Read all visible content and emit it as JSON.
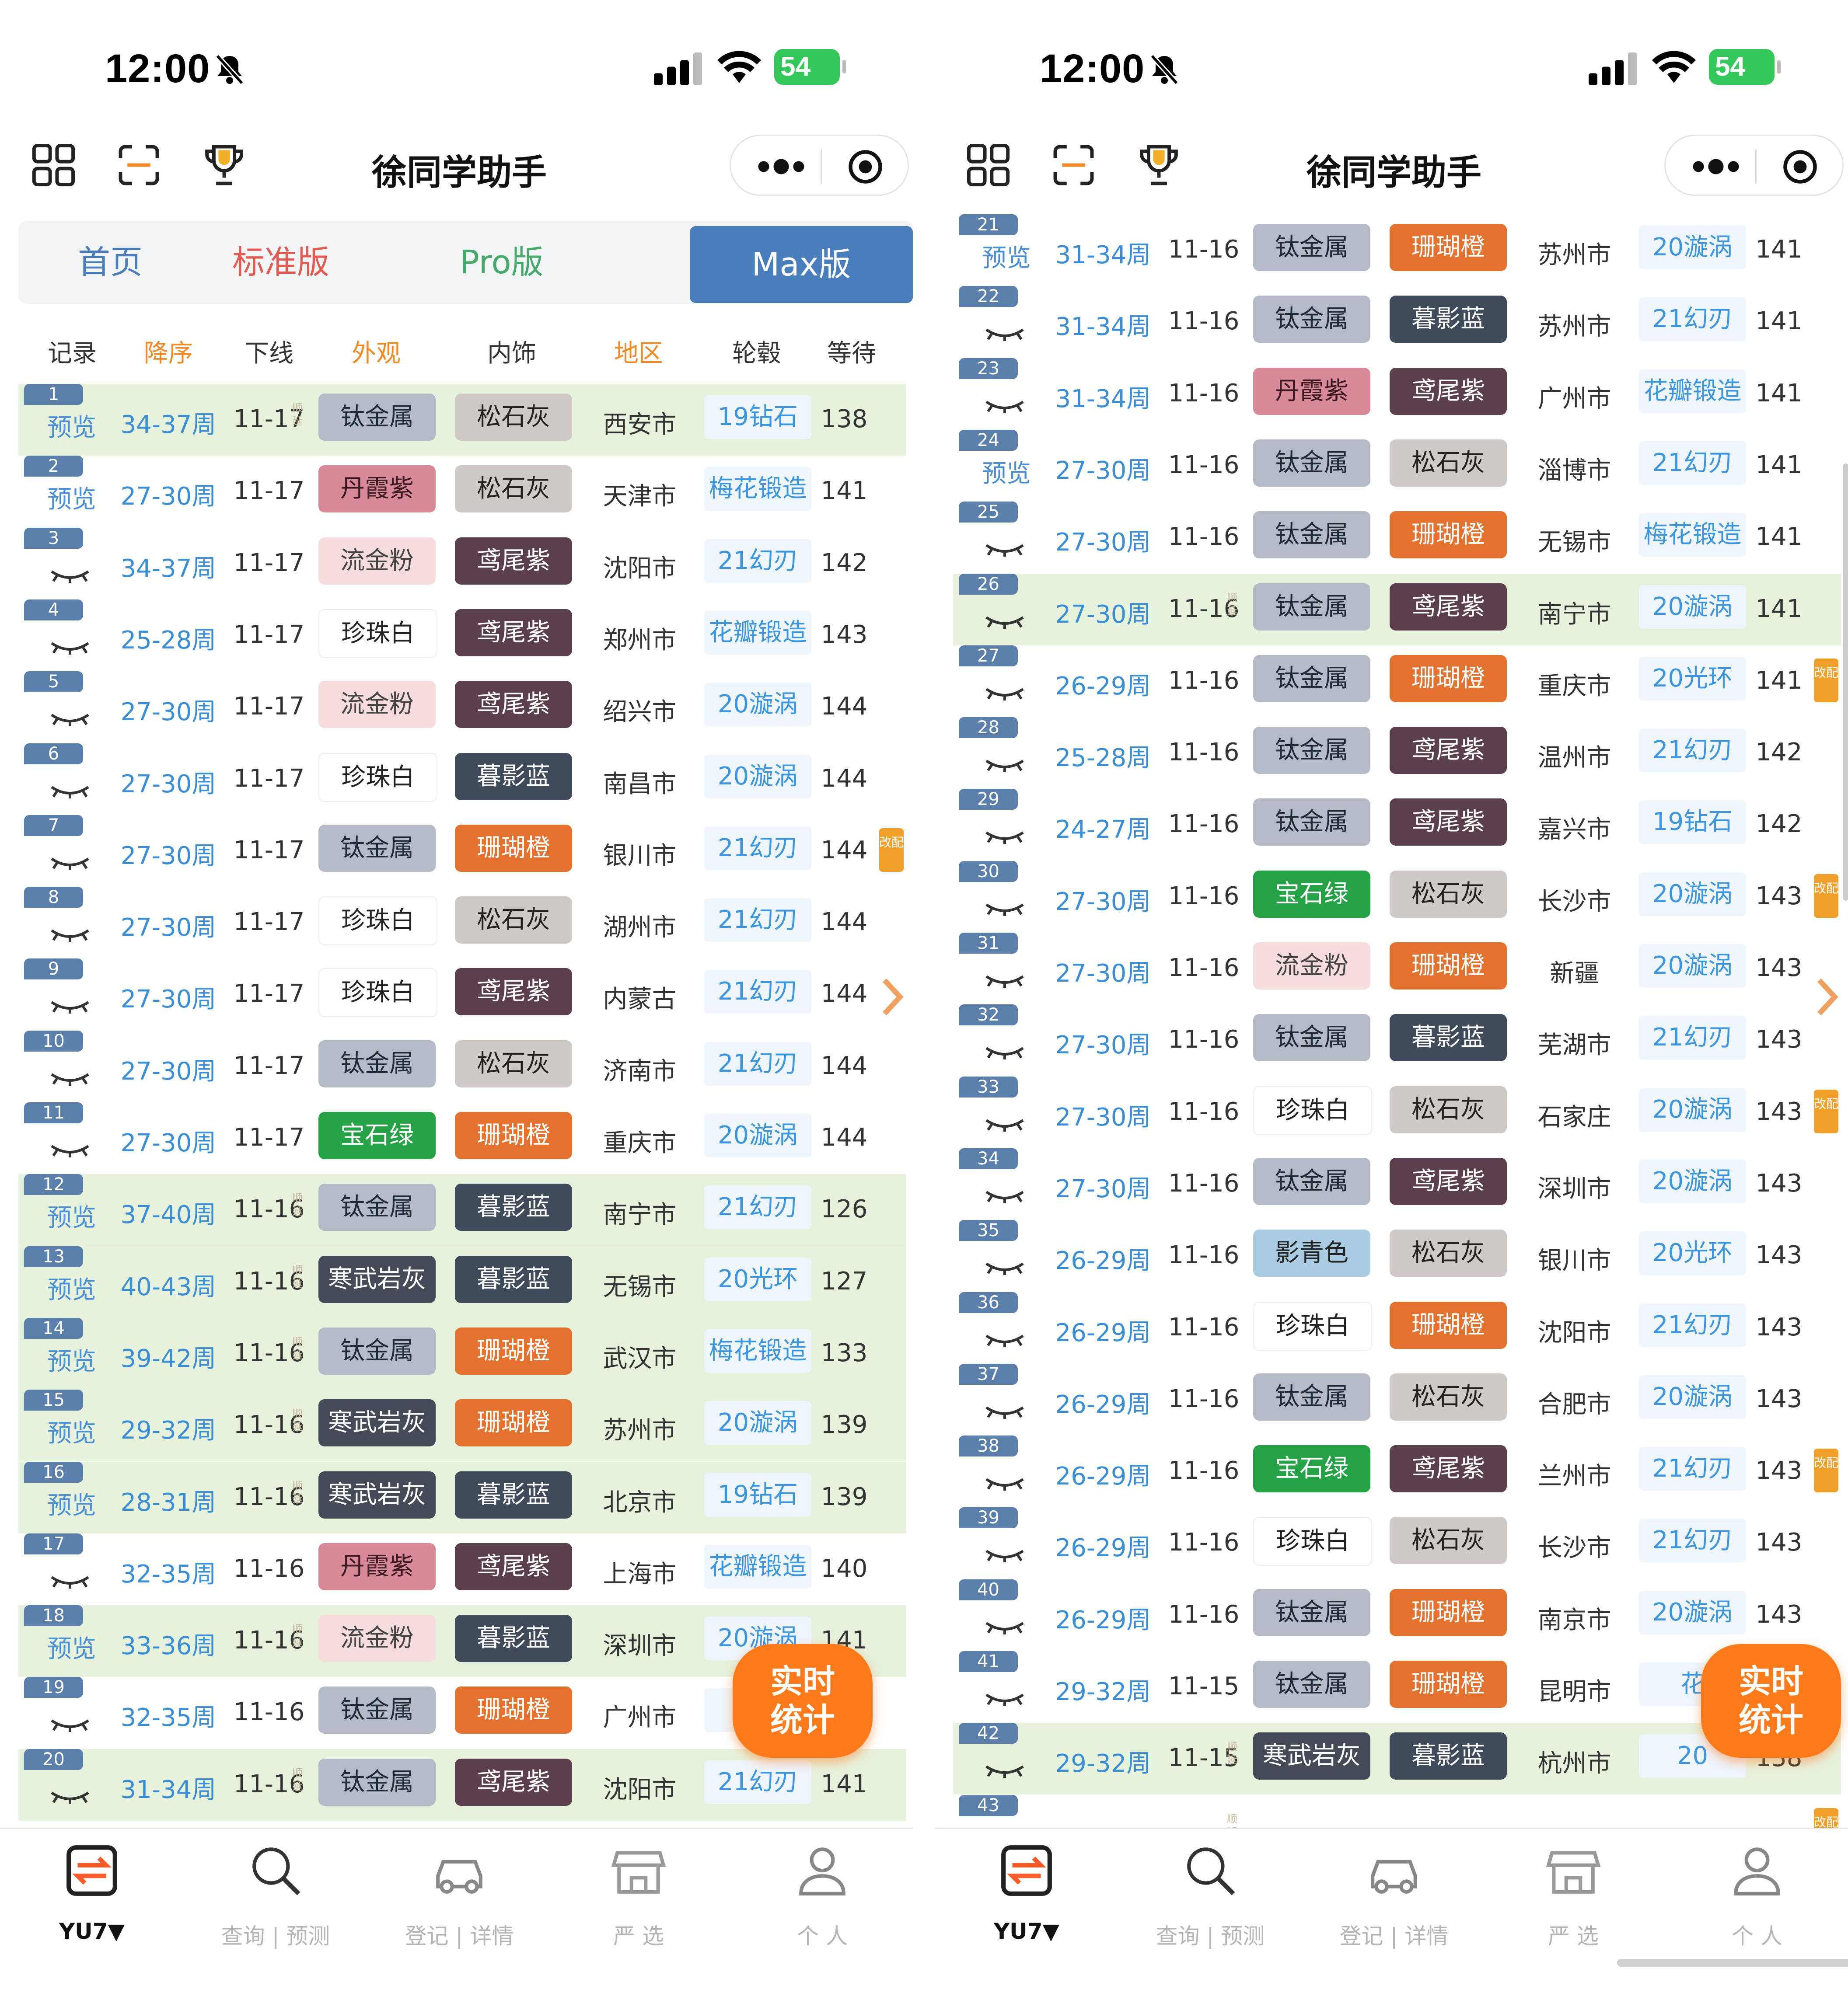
{
  "screens": [
    {
      "status": {
        "time": "12:00",
        "battery": "54"
      },
      "nav": {
        "title": "徐同学助手"
      },
      "tabs": [
        "首页",
        "标准版",
        "Pro版",
        "Max版"
      ],
      "header": [
        "记录",
        "降序",
        "下线",
        "外观",
        "内饰",
        "地区",
        "轮毂",
        "等待"
      ],
      "rows": [
        {
          "n": "1",
          "tag": "预览",
          "cycle": "34-37周",
          "date": "11-17",
          "ext": "钛金属",
          "int": "松石灰",
          "region": "西安市",
          "wheel": "19钻石",
          "wait": "138",
          "green": true,
          "stamp": true,
          "mod": false
        },
        {
          "n": "2",
          "tag": "预览",
          "cycle": "27-30周",
          "date": "11-17",
          "ext": "丹霞紫",
          "int": "松石灰",
          "region": "天津市",
          "wheel": "梅花锻造",
          "wait": "141",
          "green": false,
          "stamp": false,
          "mod": false
        },
        {
          "n": "3",
          "tag": "",
          "cycle": "34-37周",
          "date": "11-17",
          "ext": "流金粉",
          "int": "鸢尾紫",
          "region": "沈阳市",
          "wheel": "21幻刃",
          "wait": "142",
          "green": false,
          "stamp": false,
          "mod": false
        },
        {
          "n": "4",
          "tag": "",
          "cycle": "25-28周",
          "date": "11-17",
          "ext": "珍珠白",
          "int": "鸢尾紫",
          "region": "郑州市",
          "wheel": "花瓣锻造",
          "wait": "143",
          "green": false,
          "stamp": false,
          "mod": false
        },
        {
          "n": "5",
          "tag": "",
          "cycle": "27-30周",
          "date": "11-17",
          "ext": "流金粉",
          "int": "鸢尾紫",
          "region": "绍兴市",
          "wheel": "20漩涡",
          "wait": "144",
          "green": false,
          "stamp": false,
          "mod": false
        },
        {
          "n": "6",
          "tag": "",
          "cycle": "27-30周",
          "date": "11-17",
          "ext": "珍珠白",
          "int": "暮影蓝",
          "region": "南昌市",
          "wheel": "20漩涡",
          "wait": "144",
          "green": false,
          "stamp": false,
          "mod": false
        },
        {
          "n": "7",
          "tag": "",
          "cycle": "27-30周",
          "date": "11-17",
          "ext": "钛金属",
          "int": "珊瑚橙",
          "region": "银川市",
          "wheel": "21幻刃",
          "wait": "144",
          "green": false,
          "stamp": false,
          "mod": true
        },
        {
          "n": "8",
          "tag": "",
          "cycle": "27-30周",
          "date": "11-17",
          "ext": "珍珠白",
          "int": "松石灰",
          "region": "湖州市",
          "wheel": "21幻刃",
          "wait": "144",
          "green": false,
          "stamp": false,
          "mod": false
        },
        {
          "n": "9",
          "tag": "",
          "cycle": "27-30周",
          "date": "11-17",
          "ext": "珍珠白",
          "int": "鸢尾紫",
          "region": "内蒙古",
          "wheel": "21幻刃",
          "wait": "144",
          "green": false,
          "stamp": false,
          "mod": false
        },
        {
          "n": "10",
          "tag": "",
          "cycle": "27-30周",
          "date": "11-17",
          "ext": "钛金属",
          "int": "松石灰",
          "region": "济南市",
          "wheel": "21幻刃",
          "wait": "144",
          "green": false,
          "stamp": false,
          "mod": false
        },
        {
          "n": "11",
          "tag": "",
          "cycle": "27-30周",
          "date": "11-17",
          "ext": "宝石绿",
          "int": "珊瑚橙",
          "region": "重庆市",
          "wheel": "20漩涡",
          "wait": "144",
          "green": false,
          "stamp": false,
          "mod": false
        },
        {
          "n": "12",
          "tag": "预览",
          "cycle": "37-40周",
          "date": "11-16",
          "ext": "钛金属",
          "int": "暮影蓝",
          "region": "南宁市",
          "wheel": "21幻刃",
          "wait": "126",
          "green": true,
          "stamp": true,
          "mod": false
        },
        {
          "n": "13",
          "tag": "预览",
          "cycle": "40-43周",
          "date": "11-16",
          "ext": "寒武岩灰",
          "int": "暮影蓝",
          "region": "无锡市",
          "wheel": "20光环",
          "wait": "127",
          "green": true,
          "stamp": true,
          "mod": false
        },
        {
          "n": "14",
          "tag": "预览",
          "cycle": "39-42周",
          "date": "11-16",
          "ext": "钛金属",
          "int": "珊瑚橙",
          "region": "武汉市",
          "wheel": "梅花锻造",
          "wait": "133",
          "green": true,
          "stamp": true,
          "mod": false
        },
        {
          "n": "15",
          "tag": "预览",
          "cycle": "29-32周",
          "date": "11-16",
          "ext": "寒武岩灰",
          "int": "珊瑚橙",
          "region": "苏州市",
          "wheel": "20漩涡",
          "wait": "139",
          "green": true,
          "stamp": true,
          "mod": false
        },
        {
          "n": "16",
          "tag": "预览",
          "cycle": "28-31周",
          "date": "11-16",
          "ext": "寒武岩灰",
          "int": "暮影蓝",
          "region": "北京市",
          "wheel": "19钻石",
          "wait": "139",
          "green": true,
          "stamp": true,
          "mod": false
        },
        {
          "n": "17",
          "tag": "",
          "cycle": "32-35周",
          "date": "11-16",
          "ext": "丹霞紫",
          "int": "鸢尾紫",
          "region": "上海市",
          "wheel": "花瓣锻造",
          "wait": "140",
          "green": false,
          "stamp": false,
          "mod": false
        },
        {
          "n": "18",
          "tag": "预览",
          "cycle": "33-36周",
          "date": "11-16",
          "ext": "流金粉",
          "int": "暮影蓝",
          "region": "深圳市",
          "wheel": "20漩涡",
          "wait": "141",
          "green": true,
          "stamp": true,
          "mod": false
        },
        {
          "n": "19",
          "tag": "",
          "cycle": "32-35周",
          "date": "11-16",
          "ext": "钛金属",
          "int": "珊瑚橙",
          "region": "广州市",
          "wheel": "2",
          "wait": "",
          "green": false,
          "stamp": false,
          "mod": false
        },
        {
          "n": "20",
          "tag": "",
          "cycle": "31-34周",
          "date": "11-16",
          "ext": "钛金属",
          "int": "鸢尾紫",
          "region": "沈阳市",
          "wheel": "21幻刃",
          "wait": "141",
          "green": true,
          "stamp": true,
          "mod": false
        }
      ],
      "fab": {
        "line1": "实时",
        "line2": "统计"
      },
      "tabbar": [
        {
          "label": "YU7▼",
          "icon": "swap-icon"
        },
        {
          "label": "查询 | 预测",
          "icon": "search-icon"
        },
        {
          "label": "登记 | 详情",
          "icon": "car-icon"
        },
        {
          "label": "严 选",
          "icon": "store-icon"
        },
        {
          "label": "个 人",
          "icon": "person-icon"
        }
      ]
    },
    {
      "status": {
        "time": "12:00",
        "battery": "54"
      },
      "nav": {
        "title": "徐同学助手"
      },
      "rows": [
        {
          "n": "21",
          "tag": "预览",
          "cycle": "31-34周",
          "date": "11-16",
          "ext": "钛金属",
          "int": "珊瑚橙",
          "region": "苏州市",
          "wheel": "20漩涡",
          "wait": "141",
          "green": false,
          "stamp": false,
          "mod": false
        },
        {
          "n": "22",
          "tag": "",
          "cycle": "31-34周",
          "date": "11-16",
          "ext": "钛金属",
          "int": "暮影蓝",
          "region": "苏州市",
          "wheel": "21幻刃",
          "wait": "141",
          "green": false,
          "stamp": false,
          "mod": false
        },
        {
          "n": "23",
          "tag": "",
          "cycle": "31-34周",
          "date": "11-16",
          "ext": "丹霞紫",
          "int": "鸢尾紫",
          "region": "广州市",
          "wheel": "花瓣锻造",
          "wait": "141",
          "green": false,
          "stamp": false,
          "mod": false
        },
        {
          "n": "24",
          "tag": "预览",
          "cycle": "27-30周",
          "date": "11-16",
          "ext": "钛金属",
          "int": "松石灰",
          "region": "淄博市",
          "wheel": "21幻刃",
          "wait": "141",
          "green": false,
          "stamp": false,
          "mod": false
        },
        {
          "n": "25",
          "tag": "",
          "cycle": "27-30周",
          "date": "11-16",
          "ext": "钛金属",
          "int": "珊瑚橙",
          "region": "无锡市",
          "wheel": "梅花锻造",
          "wait": "141",
          "green": false,
          "stamp": false,
          "mod": false
        },
        {
          "n": "26",
          "tag": "",
          "cycle": "27-30周",
          "date": "11-16",
          "ext": "钛金属",
          "int": "鸢尾紫",
          "region": "南宁市",
          "wheel": "20漩涡",
          "wait": "141",
          "green": true,
          "stamp": true,
          "mod": false
        },
        {
          "n": "27",
          "tag": "",
          "cycle": "26-29周",
          "date": "11-16",
          "ext": "钛金属",
          "int": "珊瑚橙",
          "region": "重庆市",
          "wheel": "20光环",
          "wait": "141",
          "green": false,
          "stamp": false,
          "mod": true
        },
        {
          "n": "28",
          "tag": "",
          "cycle": "25-28周",
          "date": "11-16",
          "ext": "钛金属",
          "int": "鸢尾紫",
          "region": "温州市",
          "wheel": "21幻刃",
          "wait": "142",
          "green": false,
          "stamp": false,
          "mod": false
        },
        {
          "n": "29",
          "tag": "",
          "cycle": "24-27周",
          "date": "11-16",
          "ext": "钛金属",
          "int": "鸢尾紫",
          "region": "嘉兴市",
          "wheel": "19钻石",
          "wait": "142",
          "green": false,
          "stamp": false,
          "mod": false
        },
        {
          "n": "30",
          "tag": "",
          "cycle": "27-30周",
          "date": "11-16",
          "ext": "宝石绿",
          "int": "松石灰",
          "region": "长沙市",
          "wheel": "20漩涡",
          "wait": "143",
          "green": false,
          "stamp": false,
          "mod": true
        },
        {
          "n": "31",
          "tag": "",
          "cycle": "27-30周",
          "date": "11-16",
          "ext": "流金粉",
          "int": "珊瑚橙",
          "region": "新疆",
          "wheel": "20漩涡",
          "wait": "143",
          "green": false,
          "stamp": false,
          "mod": false
        },
        {
          "n": "32",
          "tag": "",
          "cycle": "27-30周",
          "date": "11-16",
          "ext": "钛金属",
          "int": "暮影蓝",
          "region": "芜湖市",
          "wheel": "21幻刃",
          "wait": "143",
          "green": false,
          "stamp": false,
          "mod": false
        },
        {
          "n": "33",
          "tag": "",
          "cycle": "27-30周",
          "date": "11-16",
          "ext": "珍珠白",
          "int": "松石灰",
          "region": "石家庄",
          "wheel": "20漩涡",
          "wait": "143",
          "green": false,
          "stamp": false,
          "mod": true
        },
        {
          "n": "34",
          "tag": "",
          "cycle": "27-30周",
          "date": "11-16",
          "ext": "钛金属",
          "int": "鸢尾紫",
          "region": "深圳市",
          "wheel": "20漩涡",
          "wait": "143",
          "green": false,
          "stamp": false,
          "mod": false
        },
        {
          "n": "35",
          "tag": "",
          "cycle": "26-29周",
          "date": "11-16",
          "ext": "影青色",
          "int": "松石灰",
          "region": "银川市",
          "wheel": "20光环",
          "wait": "143",
          "green": false,
          "stamp": false,
          "mod": false
        },
        {
          "n": "36",
          "tag": "",
          "cycle": "26-29周",
          "date": "11-16",
          "ext": "珍珠白",
          "int": "珊瑚橙",
          "region": "沈阳市",
          "wheel": "21幻刃",
          "wait": "143",
          "green": false,
          "stamp": false,
          "mod": false
        },
        {
          "n": "37",
          "tag": "",
          "cycle": "26-29周",
          "date": "11-16",
          "ext": "钛金属",
          "int": "松石灰",
          "region": "合肥市",
          "wheel": "20漩涡",
          "wait": "143",
          "green": false,
          "stamp": false,
          "mod": false
        },
        {
          "n": "38",
          "tag": "",
          "cycle": "26-29周",
          "date": "11-16",
          "ext": "宝石绿",
          "int": "鸢尾紫",
          "region": "兰州市",
          "wheel": "21幻刃",
          "wait": "143",
          "green": false,
          "stamp": false,
          "mod": true
        },
        {
          "n": "39",
          "tag": "",
          "cycle": "26-29周",
          "date": "11-16",
          "ext": "珍珠白",
          "int": "松石灰",
          "region": "长沙市",
          "wheel": "21幻刃",
          "wait": "143",
          "green": false,
          "stamp": false,
          "mod": false
        },
        {
          "n": "40",
          "tag": "",
          "cycle": "26-29周",
          "date": "11-16",
          "ext": "钛金属",
          "int": "珊瑚橙",
          "region": "南京市",
          "wheel": "20漩涡",
          "wait": "143",
          "green": false,
          "stamp": false,
          "mod": false
        },
        {
          "n": "41",
          "tag": "",
          "cycle": "29-32周",
          "date": "11-15",
          "ext": "钛金属",
          "int": "珊瑚橙",
          "region": "昆明市",
          "wheel": "花",
          "wait": "",
          "green": false,
          "stamp": false,
          "mod": false
        },
        {
          "n": "42",
          "tag": "",
          "cycle": "29-32周",
          "date": "11-15",
          "ext": "寒武岩灰",
          "int": "暮影蓝",
          "region": "杭州市",
          "wheel": "20",
          "wait": "138",
          "green": true,
          "stamp": true,
          "mod": false
        },
        {
          "n": "43",
          "tag": "",
          "cycle": "",
          "date": "",
          "ext": "",
          "int": "",
          "region": "",
          "wheel": "",
          "wait": "",
          "green": false,
          "stamp": true,
          "mod": true
        }
      ],
      "fab": {
        "line1": "实时",
        "line2": "统计"
      }
    }
  ],
  "labels": {
    "stamp": "顺延",
    "mod": "改配"
  },
  "colors": {
    "钛金属": {
      "bg": "#b4bac6",
      "fg": "#1f2a38"
    },
    "丹霞紫": {
      "bg": "#d88a99",
      "fg": "#3a1a20"
    },
    "流金粉": {
      "bg": "#f6dcdc",
      "fg": "#444"
    },
    "珍珠白": {
      "bg": "#ffffff",
      "fg": "#222"
    },
    "宝石绿": {
      "bg": "#25a245",
      "fg": "#ffffff"
    },
    "寒武岩灰": {
      "bg": "#454b56",
      "fg": "#ffffff"
    },
    "影青色": {
      "bg": "#a9cce3",
      "fg": "#222"
    },
    "松石灰": {
      "bg": "#cfcac5",
      "fg": "#222"
    },
    "鸢尾紫": {
      "bg": "#5c3f4d",
      "fg": "#ffffff"
    },
    "暮影蓝": {
      "bg": "#3f4a5a",
      "fg": "#ffffff"
    },
    "珊瑚橙": {
      "bg": "#e4722f",
      "fg": "#ffffff"
    },
    "accent_blue": "#4a7dbc",
    "orange": "#ff7a1a"
  }
}
